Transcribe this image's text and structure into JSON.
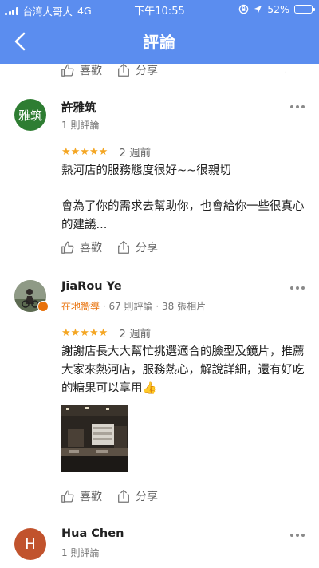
{
  "status_bar": {
    "carrier": "台湾大哥大",
    "network": "4G",
    "time": "下午10:55",
    "battery": "52%",
    "battery_level": 0.52
  },
  "header": {
    "title": "評論",
    "accent_color": "#5b8def"
  },
  "actions": {
    "like_label": "喜歡",
    "share_label": "分享"
  },
  "reviews": [
    {
      "avatar_text": "雅筑",
      "avatar_color": "#2e7d32",
      "name": "許雅筑",
      "meta": "1 則評論",
      "stars": "★★★★★",
      "rating": 5,
      "when": "2 週前",
      "text_1": "熱河店的服務態度很好~~很親切",
      "text_2": "會為了你的需求去幫助你，也會給你一些很真心的建議..."
    },
    {
      "name": "JiaRou Ye",
      "local_guide": "在地嚮導",
      "meta_rest": " · 67 則評論 · 38 張相片",
      "stars": "★★★★★",
      "rating": 5,
      "when": "2 週前",
      "text_1": "謝謝店長大大幫忙挑選適合的臉型及鏡片，推薦大家來熱河店，服務熱心，解說詳細，還有好吃的糖果可以享用👍"
    },
    {
      "avatar_text": "H",
      "avatar_color": "#c1532d",
      "name": "Hua Chen",
      "meta": "1 則評論"
    }
  ]
}
